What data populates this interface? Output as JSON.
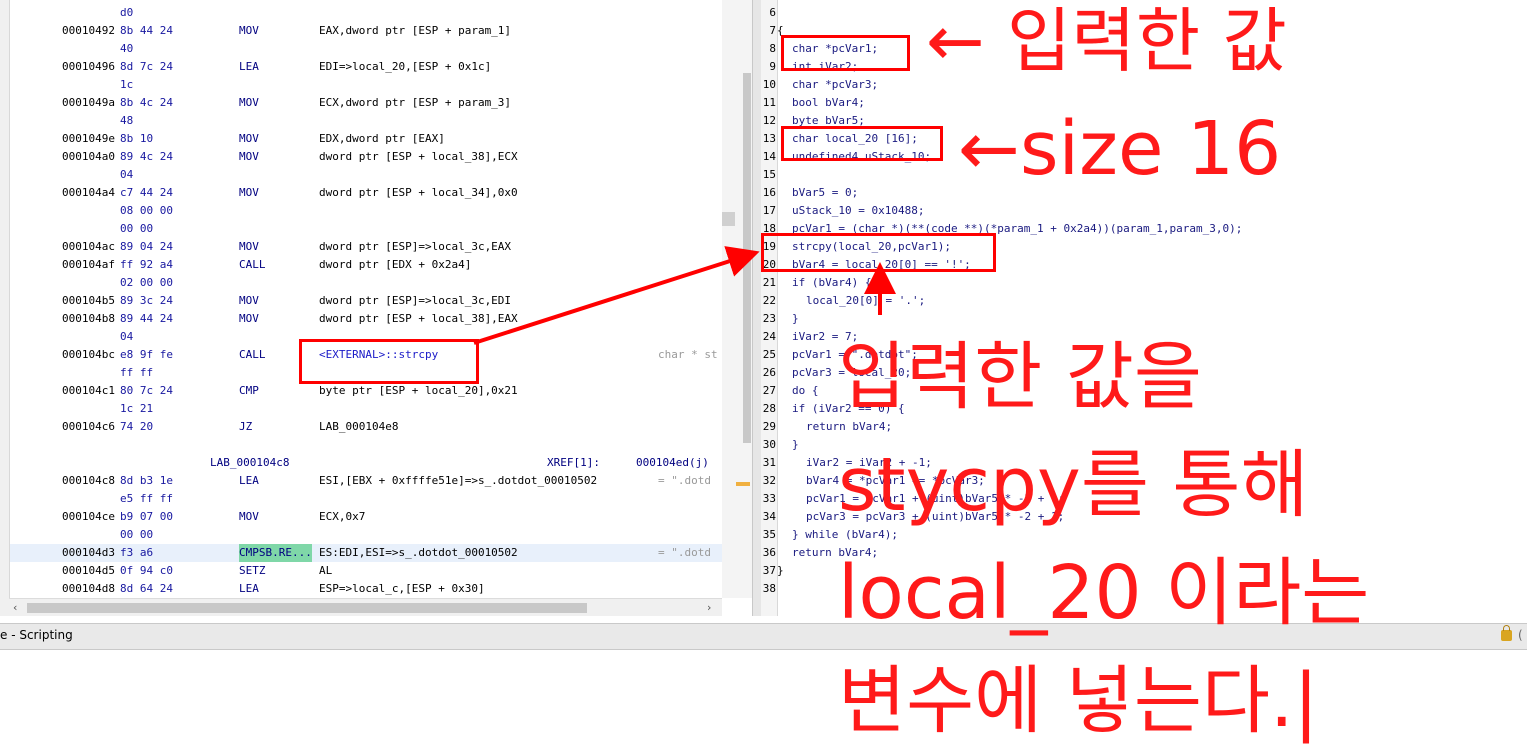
{
  "listing": {
    "rows": [
      {
        "addr": "",
        "bytes": "d0",
        "mnem": "",
        "ops": ""
      },
      {
        "addr": "00010492",
        "bytes": "8b 44 24",
        "mnem": "MOV",
        "ops": "EAX,dword ptr [ESP + param_1]"
      },
      {
        "addr": "",
        "bytes": "40",
        "mnem": "",
        "ops": ""
      },
      {
        "addr": "00010496",
        "bytes": "8d 7c 24",
        "mnem": "LEA",
        "ops": "EDI=>local_20,[ESP + 0x1c]"
      },
      {
        "addr": "",
        "bytes": "1c",
        "mnem": "",
        "ops": ""
      },
      {
        "addr": "0001049a",
        "bytes": "8b 4c 24",
        "mnem": "MOV",
        "ops": "ECX,dword ptr [ESP + param_3]"
      },
      {
        "addr": "",
        "bytes": "48",
        "mnem": "",
        "ops": ""
      },
      {
        "addr": "0001049e",
        "bytes": "8b 10",
        "mnem": "MOV",
        "ops": "EDX,dword ptr [EAX]"
      },
      {
        "addr": "000104a0",
        "bytes": "89 4c 24",
        "mnem": "MOV",
        "ops": "dword ptr [ESP + local_38],ECX"
      },
      {
        "addr": "",
        "bytes": "04",
        "mnem": "",
        "ops": ""
      },
      {
        "addr": "000104a4",
        "bytes": "c7 44 24",
        "mnem": "MOV",
        "ops": "dword ptr [ESP + local_34],0x0"
      },
      {
        "addr": "",
        "bytes": "08 00 00",
        "mnem": "",
        "ops": ""
      },
      {
        "addr": "",
        "bytes": "00 00",
        "mnem": "",
        "ops": ""
      },
      {
        "addr": "000104ac",
        "bytes": "89 04 24",
        "mnem": "MOV",
        "ops": "dword ptr [ESP]=>local_3c,EAX"
      },
      {
        "addr": "000104af",
        "bytes": "ff 92 a4",
        "mnem": "CALL",
        "ops": "dword ptr [EDX + 0x2a4]"
      },
      {
        "addr": "",
        "bytes": "02 00 00",
        "mnem": "",
        "ops": ""
      },
      {
        "addr": "000104b5",
        "bytes": "89 3c 24",
        "mnem": "MOV",
        "ops": "dword ptr [ESP]=>local_3c,EDI"
      },
      {
        "addr": "000104b8",
        "bytes": "89 44 24",
        "mnem": "MOV",
        "ops": "dword ptr [ESP + local_38],EAX"
      },
      {
        "addr": "",
        "bytes": "04",
        "mnem": "",
        "ops": ""
      },
      {
        "addr": "000104bc",
        "bytes": "e8 9f fe",
        "mnem": "CALL",
        "ops": "<EXTERNAL>::strcpy",
        "comment": "char * st"
      },
      {
        "addr": "",
        "bytes": "ff ff",
        "mnem": "",
        "ops": ""
      },
      {
        "addr": "000104c1",
        "bytes": "80 7c 24",
        "mnem": "CMP",
        "ops": "byte ptr [ESP + local_20],0x21"
      },
      {
        "addr": "",
        "bytes": "1c 21",
        "mnem": "",
        "ops": ""
      },
      {
        "addr": "000104c6",
        "bytes": "74 20",
        "mnem": "JZ",
        "ops": "LAB_000104e8"
      }
    ],
    "label_row": {
      "label": "LAB_000104c8",
      "xref": "XREF[1]:",
      "xref_addr": "000104ed(j)"
    },
    "rows2": [
      {
        "addr": "000104c8",
        "bytes": "8d b3 1e",
        "mnem": "LEA",
        "ops": "ESI,[EBX + 0xffffe51e]=>s_.dotdot_00010502",
        "comment": "= \".dotd"
      },
      {
        "addr": "",
        "bytes": "e5 ff ff",
        "mnem": "",
        "ops": ""
      },
      {
        "addr": "000104ce",
        "bytes": "b9 07 00",
        "mnem": "MOV",
        "ops": "ECX,0x7"
      },
      {
        "addr": "",
        "bytes": "00 00",
        "mnem": "",
        "ops": ""
      },
      {
        "addr": "000104d3",
        "bytes": "f3 a6",
        "mnem": "CMPSB.RE...",
        "ops": "ES:EDI,ESI=>s_.dotdot_00010502",
        "comment": "= \".dotd"
      },
      {
        "addr": "000104d5",
        "bytes": "0f 94 c0",
        "mnem": "SETZ",
        "ops": "AL"
      },
      {
        "addr": "000104d8",
        "bytes": "8d 64 24",
        "mnem": "LEA",
        "ops": "ESP=>local_c,[ESP + 0x30]"
      }
    ]
  },
  "decompile": {
    "lines": [
      {
        "n": "6",
        "text": ""
      },
      {
        "n": "7",
        "text": "{"
      },
      {
        "n": "8",
        "text": "char *pcVar1;"
      },
      {
        "n": "9",
        "text": "int iVar2;"
      },
      {
        "n": "10",
        "text": "char *pcVar3;"
      },
      {
        "n": "11",
        "text": "bool bVar4;"
      },
      {
        "n": "12",
        "text": "byte bVar5;"
      },
      {
        "n": "13",
        "text": "char local_20 [16];"
      },
      {
        "n": "14",
        "text": "undefined4 uStack_10;"
      },
      {
        "n": "15",
        "text": ""
      },
      {
        "n": "16",
        "text": "bVar5 = 0;"
      },
      {
        "n": "17",
        "text": "uStack_10 = 0x10488;"
      },
      {
        "n": "18",
        "text": "pcVar1 = (char *)(**(code **)(*param_1 + 0x2a4))(param_1,param_3,0);"
      },
      {
        "n": "19",
        "text": "strcpy(local_20,pcVar1);"
      },
      {
        "n": "20",
        "text": "bVar4 = local_20[0] == '!';"
      },
      {
        "n": "21",
        "text": "if (bVar4) {"
      },
      {
        "n": "22",
        "text": "local_20[0] = '.';"
      },
      {
        "n": "23",
        "text": "}"
      },
      {
        "n": "24",
        "text": "iVar2 = 7;"
      },
      {
        "n": "25",
        "text": "pcVar1 = \".dotdot\";"
      },
      {
        "n": "26",
        "text": "pcVar3 = local_20;"
      },
      {
        "n": "27",
        "text": "do {"
      },
      {
        "n": "28",
        "text": "if (iVar2 == 0) {"
      },
      {
        "n": "29",
        "text": "return bVar4;"
      },
      {
        "n": "30",
        "text": "}"
      },
      {
        "n": "31",
        "text": "iVar2 = iVar2 + -1;"
      },
      {
        "n": "32",
        "text": "bVar4 = *pcVar1 == *pcVar3;"
      },
      {
        "n": "33",
        "text": "pcVar1 = pcVar1 + (uint)bVar5 * -2 + 1;"
      },
      {
        "n": "34",
        "text": "pcVar3 = pcVar3 + (uint)bVar5 * -2 + 1;"
      },
      {
        "n": "35",
        "text": "} while (bVar4);"
      },
      {
        "n": "36",
        "text": "return bVar4;"
      },
      {
        "n": "37",
        "text": "}"
      },
      {
        "n": "38",
        "text": ""
      }
    ]
  },
  "statusbar": {
    "text": "e - Scripting",
    "end": "("
  },
  "annotations": {
    "input_value": "← 입력한 값",
    "size16": "←size 16",
    "line1": "입력한 값을",
    "line2": "stycpy를 통해",
    "line3": "local_20 이라는",
    "line4": "변수에 넣는다.|"
  },
  "colors": {
    "annotation": "#ff0000",
    "address_blue": "#1818a0",
    "mnemonic_navy": "#000080",
    "highlight_green": "#7fd7a8"
  }
}
